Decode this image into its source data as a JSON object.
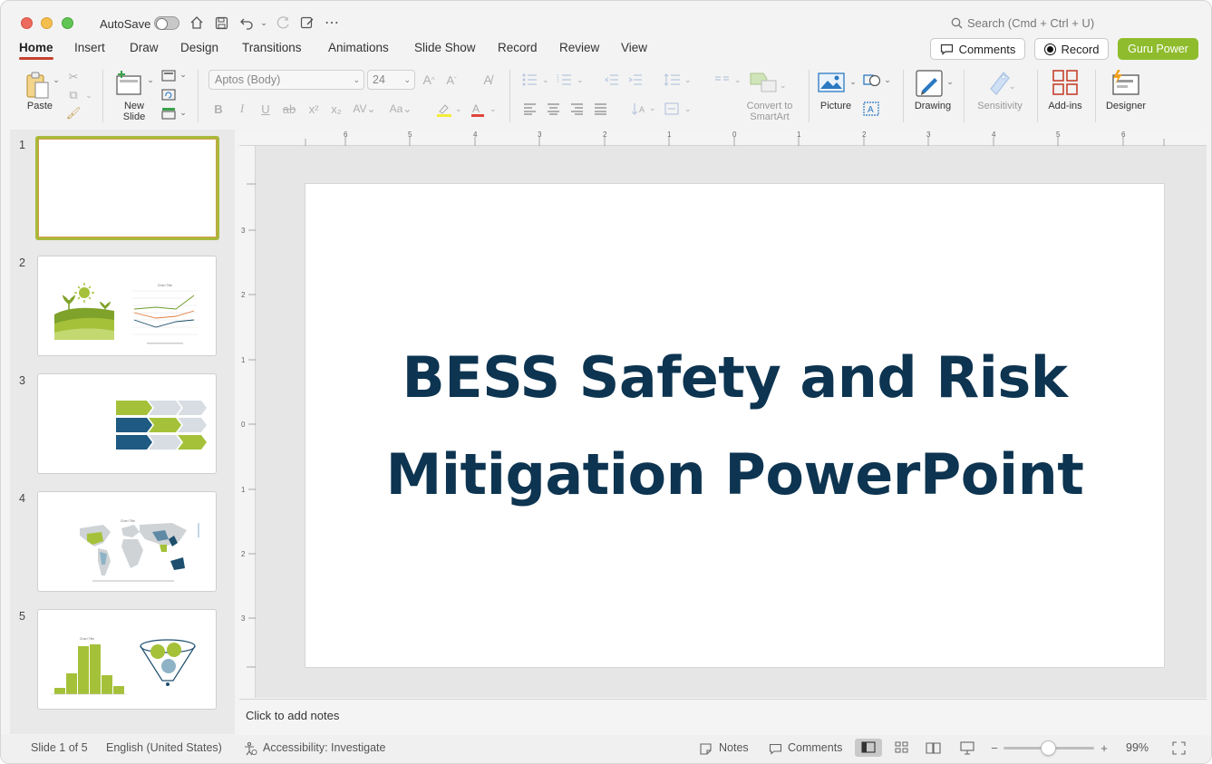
{
  "titlebar": {
    "autosave_label": "AutoSave",
    "search_placeholder": "Search (Cmd + Ctrl + U)"
  },
  "menu": {
    "tabs": [
      "Home",
      "Insert",
      "Draw",
      "Design",
      "Transitions",
      "Animations",
      "Slide Show",
      "Record",
      "Review",
      "View"
    ],
    "active_tab": "Home",
    "comments_label": "Comments",
    "record_label": "Record",
    "guru_label": "Guru Power"
  },
  "ribbon": {
    "paste_label": "Paste",
    "new_slide_label": "New Slide",
    "font_name": "Aptos (Body)",
    "font_size": "24",
    "convert_smartart_label": "Convert to SmartArt",
    "picture_label": "Picture",
    "drawing_label": "Drawing",
    "sensitivity_label": "Sensitivity",
    "addins_label": "Add-ins",
    "designer_label": "Designer"
  },
  "slides": {
    "numbers": [
      "1",
      "2",
      "3",
      "4",
      "5"
    ],
    "thumb2_chart_title": "Chart Title",
    "thumb4_chart_title": "Chart Title",
    "thumb5_chart_title": "Chart Title"
  },
  "slide": {
    "title": "BESS Safety and Risk Mitigation PowerPoint"
  },
  "notes": {
    "placeholder": "Click to add notes"
  },
  "status": {
    "slide_count": "Slide 1 of 5",
    "language": "English (United States)",
    "accessibility": "Accessibility: Investigate",
    "notes_label": "Notes",
    "comments_label": "Comments",
    "zoom": "99%"
  },
  "colors": {
    "accent_green": "#8fbc2c",
    "title_navy": "#0d3450",
    "tab_underline": "#c6422e"
  }
}
